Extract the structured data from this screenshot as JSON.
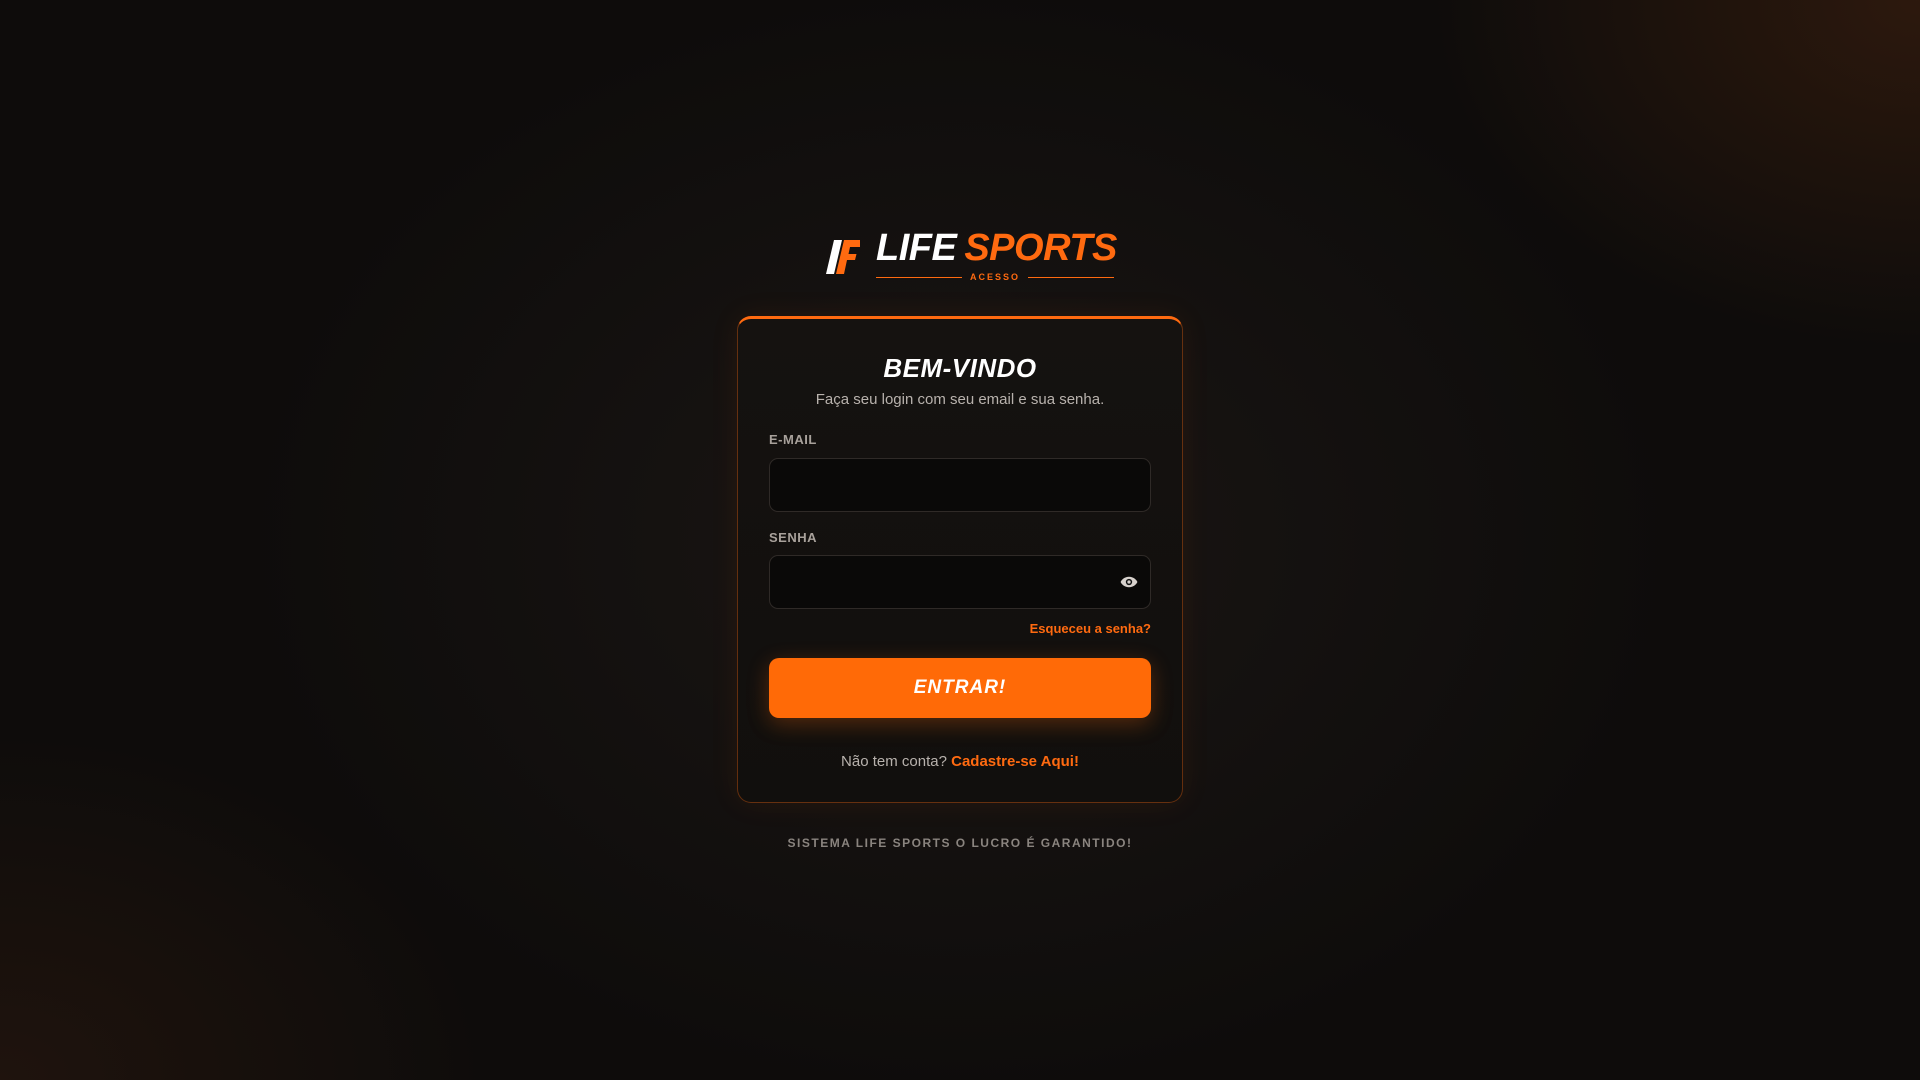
{
  "brand": {
    "name_white": "LIFE",
    "name_orange": "SPORTS",
    "subtitle": "ACESSO",
    "accent_color": "#ff6a10",
    "logo_icon": "lf-monogram-icon"
  },
  "card": {
    "title": "BEM-VINDO",
    "subtitle": "Faça seu login com seu email e sua senha."
  },
  "email": {
    "label": "E-MAIL",
    "value": "",
    "placeholder": ""
  },
  "password": {
    "label": "SENHA",
    "value": "",
    "placeholder": "",
    "toggle_icon": "eye-icon"
  },
  "forgot_link": "Esqueceu a senha?",
  "submit_label": "ENTRAR!",
  "signup": {
    "prompt": "Não tem conta?",
    "link": "Cadastre-se Aqui!"
  },
  "footer": "SISTEMA LIFE SPORTS O LUCRO É GARANTIDO!"
}
